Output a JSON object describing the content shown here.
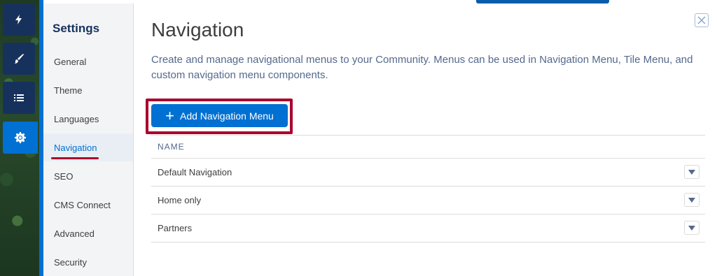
{
  "rail": {
    "buttons": [
      {
        "icon": "lightning-icon"
      },
      {
        "icon": "brush-icon"
      },
      {
        "icon": "list-icon"
      },
      {
        "icon": "gear-icon",
        "active": true
      }
    ]
  },
  "settings": {
    "title": "Settings",
    "items": [
      {
        "label": "General"
      },
      {
        "label": "Theme"
      },
      {
        "label": "Languages"
      },
      {
        "label": "Navigation",
        "selected": true
      },
      {
        "label": "SEO"
      },
      {
        "label": "CMS Connect"
      },
      {
        "label": "Advanced"
      },
      {
        "label": "Security"
      }
    ]
  },
  "main": {
    "title": "Navigation",
    "description": "Create and manage navigational menus to your Community. Menus can be used in Navigation Menu, Tile Menu, and custom navigation menu components.",
    "add_button_label": "Add Navigation Menu",
    "table": {
      "header": "NAME",
      "rows": [
        {
          "name": "Default Navigation"
        },
        {
          "name": "Home only"
        },
        {
          "name": "Partners"
        }
      ]
    }
  },
  "colors": {
    "brand": "#0070d2",
    "highlight": "#a8062e",
    "rail_button": "#16325c"
  }
}
